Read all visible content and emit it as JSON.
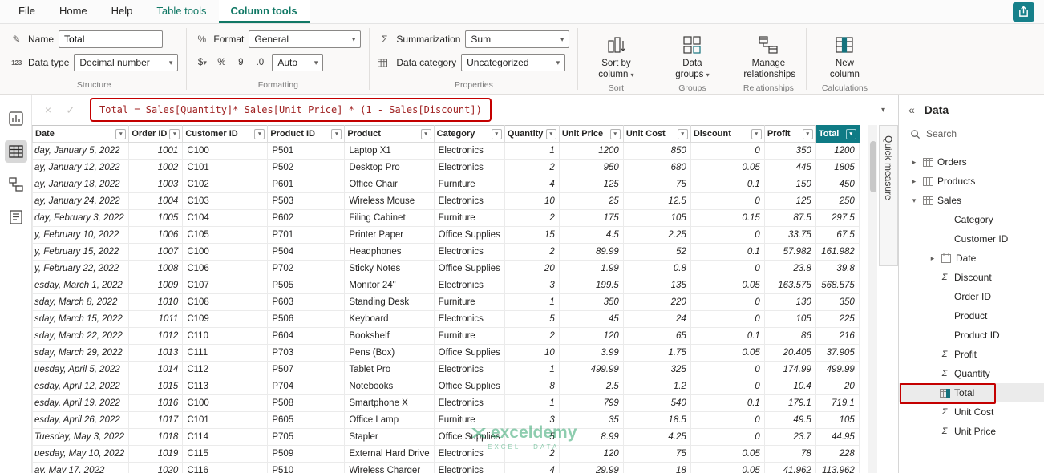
{
  "colors": {
    "accent_teal": "#117865",
    "total_header_teal": "#0f7b85",
    "annotation_red": "#c40000",
    "formula_text_red": "#a02323",
    "watermark_green": "#1f9d61"
  },
  "icons": {
    "sigma": "Σ",
    "chevron_down": "▾",
    "chevron_right": "▸",
    "collapse_double": "«",
    "cancel": "×",
    "check": "✓",
    "rename": "✎",
    "digits": "123",
    "dollar": "$",
    "percent": "%",
    "comma_style": "9",
    "decimal_style": ".0"
  },
  "tabs": [
    {
      "label": "File"
    },
    {
      "label": "Home"
    },
    {
      "label": "Help"
    },
    {
      "label": "Table tools",
      "contextual": true
    },
    {
      "label": "Column tools",
      "contextual": true,
      "active": true
    }
  ],
  "ribbon": {
    "structure": {
      "group_label": "Structure",
      "name_label": "Name",
      "name_value": "Total",
      "datatype_label": "Data type",
      "datatype_value": "Decimal number"
    },
    "formatting": {
      "group_label": "Formatting",
      "format_label": "Format",
      "format_value": "General",
      "auto_value": "Auto"
    },
    "properties": {
      "group_label": "Properties",
      "summarization_label": "Summarization",
      "summarization_value": "Sum",
      "datacategory_label": "Data category",
      "datacategory_value": "Uncategorized"
    },
    "sort": {
      "group_label": "Sort",
      "button_label": "Sort by column"
    },
    "groups": {
      "group_label": "Groups",
      "button_label": "Data groups"
    },
    "relationships": {
      "group_label": "Relationships",
      "button_label": "Manage relationships"
    },
    "calculations": {
      "group_label": "Calculations",
      "button_label": "New column"
    }
  },
  "formula_bar": {
    "text": "Total = Sales[Quantity]* Sales[Unit Price] * (1 - Sales[Discount])"
  },
  "table": {
    "columns": [
      "Date",
      "Order ID",
      "Customer ID",
      "Product ID",
      "Product",
      "Category",
      "Quantity",
      "Unit Price",
      "Unit Cost",
      "Discount",
      "Profit",
      "Total"
    ],
    "rows": [
      [
        "day, January 5, 2022",
        "1001",
        "C100",
        "P501",
        "Laptop X1",
        "Electronics",
        "1",
        "1200",
        "850",
        "0",
        "350",
        "1200"
      ],
      [
        "ay, January 12, 2022",
        "1002",
        "C101",
        "P502",
        "Desktop Pro",
        "Electronics",
        "2",
        "950",
        "680",
        "0.05",
        "445",
        "1805"
      ],
      [
        "ay, January 18, 2022",
        "1003",
        "C102",
        "P601",
        "Office Chair",
        "Furniture",
        "4",
        "125",
        "75",
        "0.1",
        "150",
        "450"
      ],
      [
        "ay, January 24, 2022",
        "1004",
        "C103",
        "P503",
        "Wireless Mouse",
        "Electronics",
        "10",
        "25",
        "12.5",
        "0",
        "125",
        "250"
      ],
      [
        "day, February 3, 2022",
        "1005",
        "C104",
        "P602",
        "Filing Cabinet",
        "Furniture",
        "2",
        "175",
        "105",
        "0.15",
        "87.5",
        "297.5"
      ],
      [
        "y, February 10, 2022",
        "1006",
        "C105",
        "P701",
        "Printer Paper",
        "Office Supplies",
        "15",
        "4.5",
        "2.25",
        "0",
        "33.75",
        "67.5"
      ],
      [
        "y, February 15, 2022",
        "1007",
        "C100",
        "P504",
        "Headphones",
        "Electronics",
        "2",
        "89.99",
        "52",
        "0.1",
        "57.982",
        "161.982"
      ],
      [
        "y, February 22, 2022",
        "1008",
        "C106",
        "P702",
        "Sticky Notes",
        "Office Supplies",
        "20",
        "1.99",
        "0.8",
        "0",
        "23.8",
        "39.8"
      ],
      [
        "esday, March 1, 2022",
        "1009",
        "C107",
        "P505",
        "Monitor 24\"",
        "Electronics",
        "3",
        "199.5",
        "135",
        "0.05",
        "163.575",
        "568.575"
      ],
      [
        "sday, March 8, 2022",
        "1010",
        "C108",
        "P603",
        "Standing Desk",
        "Furniture",
        "1",
        "350",
        "220",
        "0",
        "130",
        "350"
      ],
      [
        "sday, March 15, 2022",
        "1011",
        "C109",
        "P506",
        "Keyboard",
        "Electronics",
        "5",
        "45",
        "24",
        "0",
        "105",
        "225"
      ],
      [
        "sday, March 22, 2022",
        "1012",
        "C110",
        "P604",
        "Bookshelf",
        "Furniture",
        "2",
        "120",
        "65",
        "0.1",
        "86",
        "216"
      ],
      [
        "sday, March 29, 2022",
        "1013",
        "C111",
        "P703",
        "Pens (Box)",
        "Office Supplies",
        "10",
        "3.99",
        "1.75",
        "0.05",
        "20.405",
        "37.905"
      ],
      [
        "uesday, April 5, 2022",
        "1014",
        "C112",
        "P507",
        "Tablet Pro",
        "Electronics",
        "1",
        "499.99",
        "325",
        "0",
        "174.99",
        "499.99"
      ],
      [
        "esday, April 12, 2022",
        "1015",
        "C113",
        "P704",
        "Notebooks",
        "Office Supplies",
        "8",
        "2.5",
        "1.2",
        "0",
        "10.4",
        "20"
      ],
      [
        "esday, April 19, 2022",
        "1016",
        "C100",
        "P508",
        "Smartphone X",
        "Electronics",
        "1",
        "799",
        "540",
        "0.1",
        "179.1",
        "719.1"
      ],
      [
        "esday, April 26, 2022",
        "1017",
        "C101",
        "P605",
        "Office Lamp",
        "Furniture",
        "3",
        "35",
        "18.5",
        "0",
        "49.5",
        "105"
      ],
      [
        "Tuesday, May 3, 2022",
        "1018",
        "C114",
        "P705",
        "Stapler",
        "Office Supplies",
        "5",
        "8.99",
        "4.25",
        "0",
        "23.7",
        "44.95"
      ],
      [
        "uesday, May 10, 2022",
        "1019",
        "C115",
        "P509",
        "External Hard Drive",
        "Electronics",
        "2",
        "120",
        "75",
        "0.05",
        "78",
        "228"
      ],
      [
        "ay, May 17, 2022",
        "1020",
        "C116",
        "P510",
        "Wireless Charger",
        "Electronics",
        "4",
        "29.99",
        "18",
        "0.05",
        "41.962",
        "113.962"
      ]
    ]
  },
  "quick_measure_label": "Quick measure",
  "data_pane": {
    "title": "Data",
    "search_placeholder": "Search",
    "tree": [
      {
        "label": "Orders",
        "kind": "table",
        "expanded": false
      },
      {
        "label": "Products",
        "kind": "table",
        "expanded": false
      },
      {
        "label": "Sales",
        "kind": "table",
        "expanded": true
      },
      {
        "label": "Category",
        "kind": "field",
        "icon": "none"
      },
      {
        "label": "Customer ID",
        "kind": "field",
        "icon": "none"
      },
      {
        "label": "Date",
        "kind": "field",
        "icon": "calendar",
        "chevron": true
      },
      {
        "label": "Discount",
        "kind": "field",
        "icon": "sigma"
      },
      {
        "label": "Order ID",
        "kind": "field",
        "icon": "none"
      },
      {
        "label": "Product",
        "kind": "field",
        "icon": "none"
      },
      {
        "label": "Product ID",
        "kind": "field",
        "icon": "none"
      },
      {
        "label": "Profit",
        "kind": "field",
        "icon": "sigma"
      },
      {
        "label": "Quantity",
        "kind": "field",
        "icon": "sigma"
      },
      {
        "label": "Total",
        "kind": "field",
        "icon": "calc",
        "selected": true
      },
      {
        "label": "Unit Cost",
        "kind": "field",
        "icon": "sigma"
      },
      {
        "label": "Unit Price",
        "kind": "field",
        "icon": "sigma"
      }
    ]
  },
  "watermark": {
    "name": "exceldemy",
    "tagline": "EXCEL · DATA"
  }
}
